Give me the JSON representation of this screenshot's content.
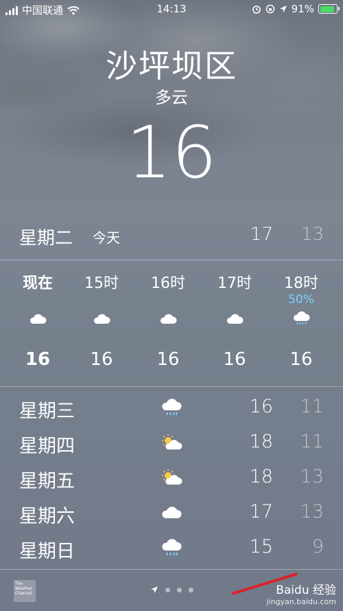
{
  "status_bar": {
    "carrier": "中国联通",
    "time": "14:13",
    "battery_percent": "91%"
  },
  "location": {
    "city": "沙坪坝区",
    "condition": "多云",
    "temperature": "16"
  },
  "today": {
    "day": "星期二",
    "label": "今天",
    "high": "17",
    "low": "13"
  },
  "hourly": [
    {
      "time": "现在",
      "icon": "cloud-icon",
      "temp": "16",
      "precip": ""
    },
    {
      "time": "15时",
      "icon": "cloud-icon",
      "temp": "16",
      "precip": ""
    },
    {
      "time": "16时",
      "icon": "cloud-icon",
      "temp": "16",
      "precip": ""
    },
    {
      "time": "17时",
      "icon": "cloud-icon",
      "temp": "16",
      "precip": ""
    },
    {
      "time": "18时",
      "icon": "rain-cloud-icon",
      "temp": "16",
      "precip": "50%"
    }
  ],
  "daily": [
    {
      "day": "星期三",
      "icon": "rain-cloud-icon",
      "high": "16",
      "low": "11"
    },
    {
      "day": "星期四",
      "icon": "partly-sunny-icon",
      "high": "18",
      "low": "11"
    },
    {
      "day": "星期五",
      "icon": "partly-sunny-icon",
      "high": "18",
      "low": "13"
    },
    {
      "day": "星期六",
      "icon": "cloud-icon",
      "high": "17",
      "low": "13"
    },
    {
      "day": "星期日",
      "icon": "rain-cloud-icon",
      "high": "15",
      "low": "9"
    }
  ],
  "footer": {
    "weather_channel_logo": "The Weather Channel",
    "watermark_brand": "Baidu 经验",
    "watermark_url": "jingyan.baidu.com"
  },
  "colors": {
    "precip_text": "#7fd2ff",
    "battery_fill": "#4cd964",
    "annotation_line": "#d9222a"
  }
}
